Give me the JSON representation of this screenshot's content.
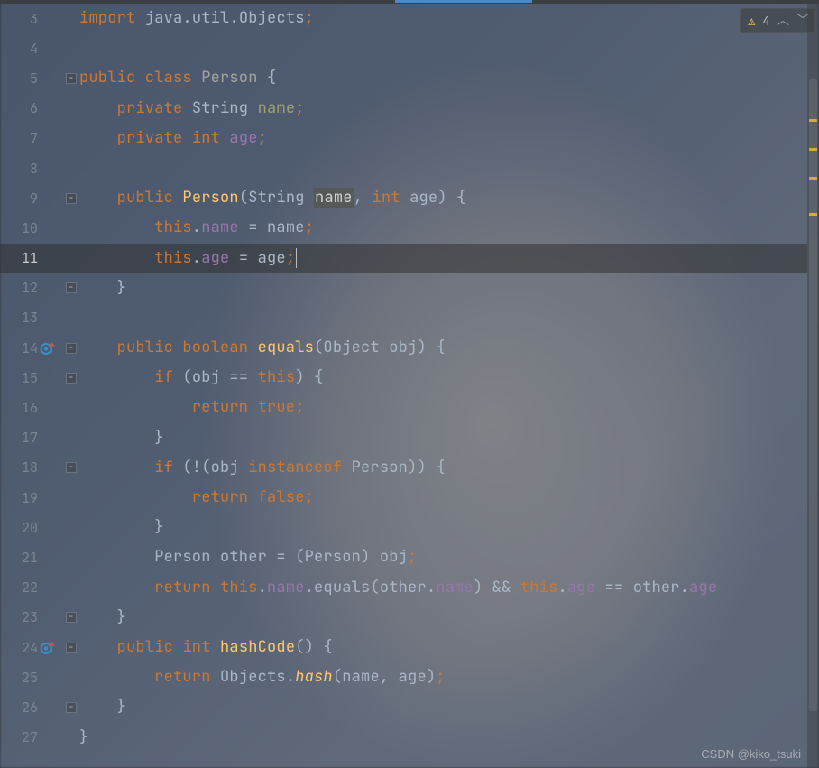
{
  "analysis": {
    "warning_count": "4"
  },
  "watermark": "CSDN @kiko_tsuki",
  "icons": {
    "override": "override-up-icon",
    "fold": "fold-minus-icon",
    "warning": "warning-triangle-icon",
    "chev_up": "chevron-up-icon",
    "chev_down": "chevron-down-icon"
  },
  "colors": {
    "keyword": "#cc7832",
    "field": "#9876aa",
    "method": "#ffc66d",
    "text": "#a9b7c6",
    "lineHighlight": "#323232"
  },
  "editor": {
    "current_line": 11,
    "lines": [
      {
        "n": 3,
        "indent": 0,
        "fold": false,
        "ov": false,
        "tokens": [
          [
            "kw",
            "import "
          ],
          [
            "typ",
            "java"
          ],
          [
            "op",
            "."
          ],
          [
            "typ",
            "util"
          ],
          [
            "op",
            "."
          ],
          [
            "typ",
            "Objects"
          ],
          [
            "semi",
            ";"
          ]
        ]
      },
      {
        "n": 4,
        "indent": 0,
        "fold": false,
        "ov": false,
        "tokens": []
      },
      {
        "n": 5,
        "indent": 0,
        "fold": true,
        "ov": false,
        "tokens": [
          [
            "kw",
            "public class "
          ],
          [
            "cls",
            "Person"
          ],
          [
            "pun",
            " {"
          ]
        ]
      },
      {
        "n": 6,
        "indent": 1,
        "fold": false,
        "ov": false,
        "tokens": [
          [
            "kw",
            "private "
          ],
          [
            "typ",
            "String "
          ],
          [
            "decl",
            "name"
          ],
          [
            "semi",
            ";"
          ]
        ]
      },
      {
        "n": 7,
        "indent": 1,
        "fold": false,
        "ov": false,
        "tokens": [
          [
            "kw",
            "private int "
          ],
          [
            "fld",
            "age"
          ],
          [
            "semi",
            ";"
          ]
        ]
      },
      {
        "n": 8,
        "indent": 0,
        "fold": false,
        "ov": false,
        "tokens": []
      },
      {
        "n": 9,
        "indent": 1,
        "fold": true,
        "ov": false,
        "tokens": [
          [
            "kw",
            "public "
          ],
          [
            "mth",
            "Person"
          ],
          [
            "pun",
            "("
          ],
          [
            "typ",
            "String "
          ],
          [
            "parh",
            "name"
          ],
          [
            "pun",
            ", "
          ],
          [
            "kw",
            "int "
          ],
          [
            "par",
            "age"
          ],
          [
            "pun",
            ") {"
          ]
        ]
      },
      {
        "n": 10,
        "indent": 2,
        "fold": false,
        "ov": false,
        "tokens": [
          [
            "kw",
            "this"
          ],
          [
            "op",
            "."
          ],
          [
            "fld",
            "name"
          ],
          [
            "op",
            " = "
          ],
          [
            "par",
            "name"
          ],
          [
            "semi",
            ";"
          ]
        ]
      },
      {
        "n": 11,
        "indent": 2,
        "fold": false,
        "ov": false,
        "tokens": [
          [
            "kw",
            "this"
          ],
          [
            "op",
            "."
          ],
          [
            "fld",
            "age"
          ],
          [
            "op",
            " = "
          ],
          [
            "par",
            "age"
          ],
          [
            "semi",
            ";"
          ]
        ]
      },
      {
        "n": 12,
        "indent": 1,
        "fold": true,
        "ov": false,
        "tokens": [
          [
            "pun",
            "}"
          ]
        ]
      },
      {
        "n": 13,
        "indent": 0,
        "fold": false,
        "ov": false,
        "tokens": []
      },
      {
        "n": 14,
        "indent": 1,
        "fold": true,
        "ov": true,
        "tokens": [
          [
            "kw",
            "public boolean "
          ],
          [
            "mth",
            "equals"
          ],
          [
            "pun",
            "("
          ],
          [
            "typ",
            "Object "
          ],
          [
            "par",
            "obj"
          ],
          [
            "pun",
            ") {"
          ]
        ]
      },
      {
        "n": 15,
        "indent": 2,
        "fold": true,
        "ov": false,
        "tokens": [
          [
            "kw",
            "if "
          ],
          [
            "pun",
            "("
          ],
          [
            "par",
            "obj"
          ],
          [
            "op",
            " == "
          ],
          [
            "kw",
            "this"
          ],
          [
            "pun",
            ") {"
          ]
        ]
      },
      {
        "n": 16,
        "indent": 3,
        "fold": false,
        "ov": false,
        "tokens": [
          [
            "kw",
            "return true"
          ],
          [
            "semi",
            ";"
          ]
        ]
      },
      {
        "n": 17,
        "indent": 2,
        "fold": false,
        "ov": false,
        "tokens": [
          [
            "pun",
            "}"
          ]
        ]
      },
      {
        "n": 18,
        "indent": 2,
        "fold": true,
        "ov": false,
        "tokens": [
          [
            "kw",
            "if "
          ],
          [
            "pun",
            "(!("
          ],
          [
            "par",
            "obj"
          ],
          [
            "op",
            " "
          ],
          [
            "kw",
            "instanceof "
          ],
          [
            "typ",
            "Person"
          ],
          [
            "pun",
            ")) {"
          ]
        ]
      },
      {
        "n": 19,
        "indent": 3,
        "fold": false,
        "ov": false,
        "tokens": [
          [
            "kw",
            "return false"
          ],
          [
            "semi",
            ";"
          ]
        ]
      },
      {
        "n": 20,
        "indent": 2,
        "fold": false,
        "ov": false,
        "tokens": [
          [
            "pun",
            "}"
          ]
        ]
      },
      {
        "n": 21,
        "indent": 2,
        "fold": false,
        "ov": false,
        "tokens": [
          [
            "typ",
            "Person other "
          ],
          [
            "op",
            "= ("
          ],
          [
            "typ",
            "Person"
          ],
          [
            "op",
            ") "
          ],
          [
            "par",
            "obj"
          ],
          [
            "semi",
            ";"
          ]
        ]
      },
      {
        "n": 22,
        "indent": 2,
        "fold": false,
        "ov": false,
        "tokens": [
          [
            "kw",
            "return this"
          ],
          [
            "op",
            "."
          ],
          [
            "fld",
            "name"
          ],
          [
            "op",
            "."
          ],
          [
            "typ",
            "equals"
          ],
          [
            "pun",
            "("
          ],
          [
            "par",
            "other"
          ],
          [
            "op",
            "."
          ],
          [
            "fld",
            "name"
          ],
          [
            "pun",
            ")"
          ],
          [
            "op",
            " && "
          ],
          [
            "kw",
            "this"
          ],
          [
            "op",
            "."
          ],
          [
            "fld",
            "age"
          ],
          [
            "op",
            " == "
          ],
          [
            "par",
            "other"
          ],
          [
            "op",
            "."
          ],
          [
            "fld",
            "age"
          ]
        ]
      },
      {
        "n": 23,
        "indent": 1,
        "fold": true,
        "ov": false,
        "tokens": [
          [
            "pun",
            "}"
          ]
        ]
      },
      {
        "n": 24,
        "indent": 1,
        "fold": true,
        "ov": true,
        "tokens": [
          [
            "kw",
            "public int "
          ],
          [
            "mth",
            "hashCode"
          ],
          [
            "pun",
            "() {"
          ]
        ]
      },
      {
        "n": 25,
        "indent": 2,
        "fold": false,
        "ov": false,
        "tokens": [
          [
            "kw",
            "return "
          ],
          [
            "typ",
            "Objects"
          ],
          [
            "op",
            "."
          ],
          [
            "mthi",
            "hash"
          ],
          [
            "pun",
            "("
          ],
          [
            "par",
            "name"
          ],
          [
            "pun",
            ", "
          ],
          [
            "par",
            "age"
          ],
          [
            "pun",
            ")"
          ],
          [
            "semi",
            ";"
          ]
        ]
      },
      {
        "n": 26,
        "indent": 1,
        "fold": true,
        "ov": false,
        "tokens": [
          [
            "pun",
            "}"
          ]
        ]
      },
      {
        "n": 27,
        "indent": 0,
        "fold": false,
        "ov": false,
        "tokens": [
          [
            "pun",
            "}"
          ]
        ]
      }
    ]
  },
  "stripe_marks": [
    128,
    160,
    192,
    232
  ]
}
